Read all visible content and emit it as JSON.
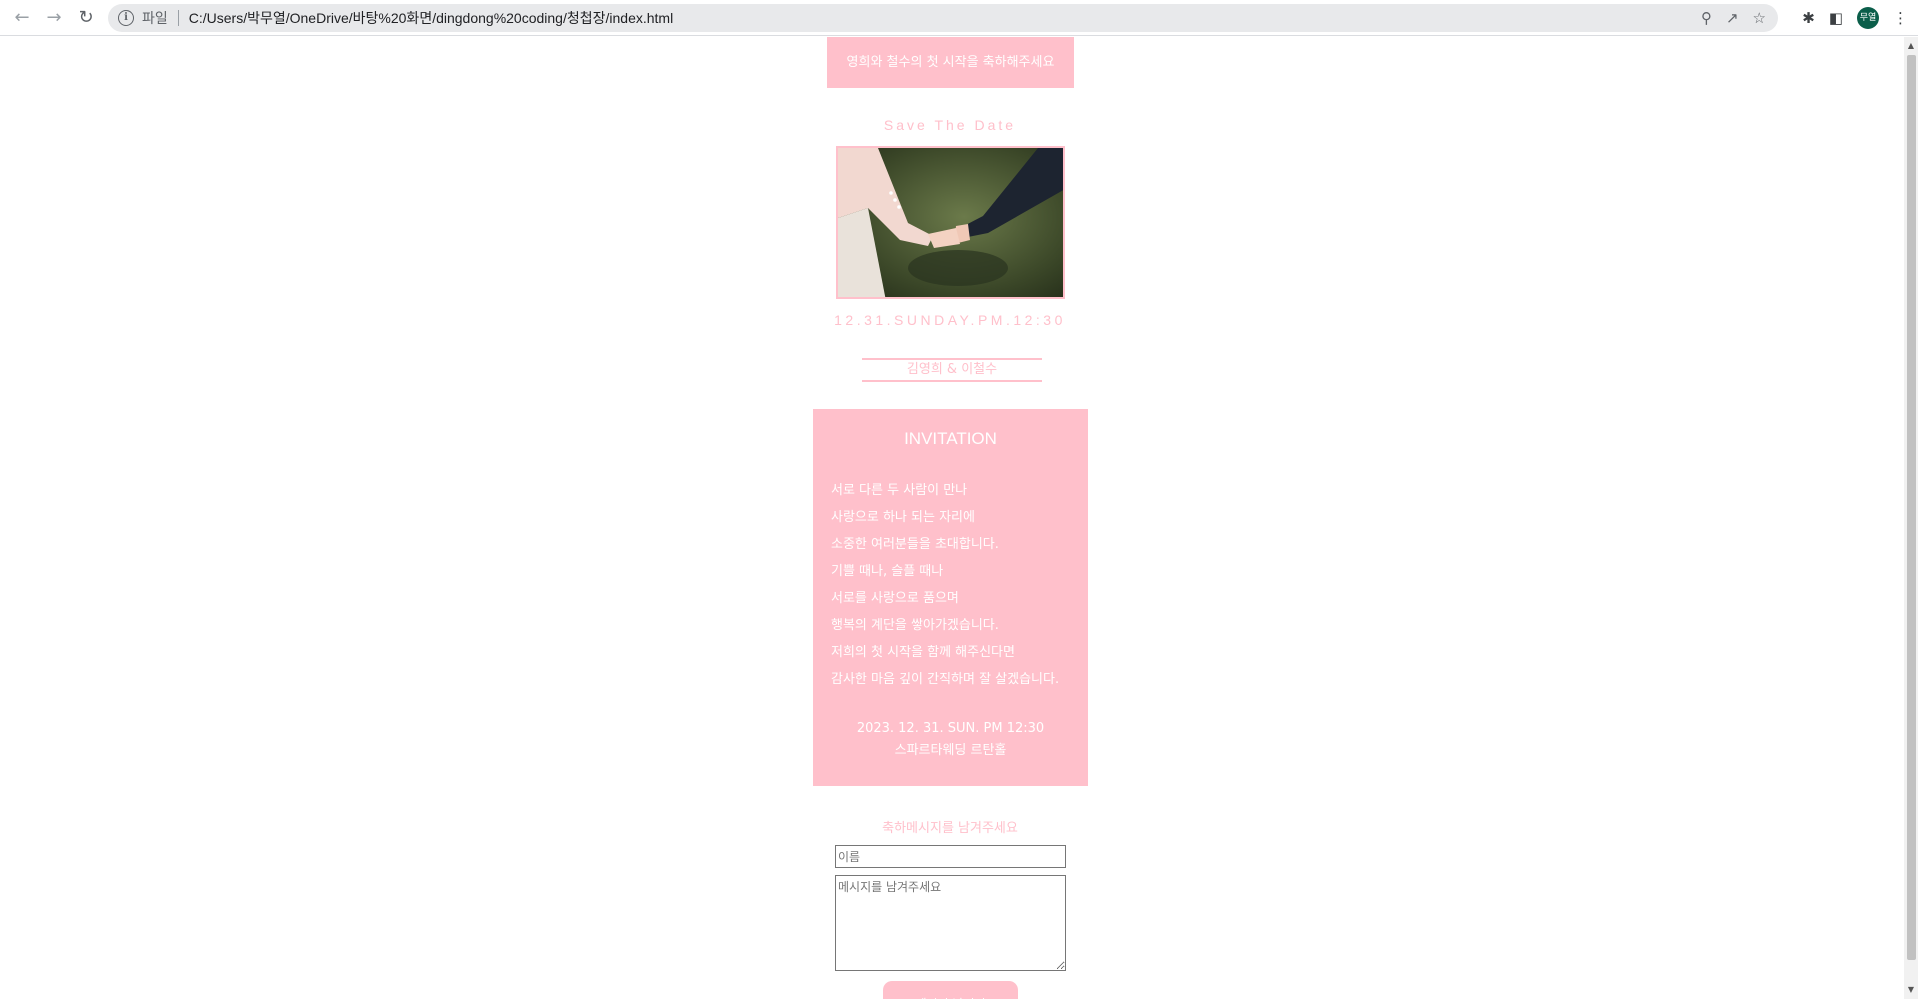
{
  "browser": {
    "scheme_label": "파일",
    "url": "C:/Users/박무열/OneDrive/바탕%20화면/dingdong%20coding/청첩장/index.html",
    "avatar_text": "무열"
  },
  "page": {
    "banner": "영희와 철수의 첫 시작을 축하해주세요",
    "save_the_date": "Save The Date",
    "date_line": "12.31.SUNDAY.PM.12:30",
    "couple_names": "김영희 & 이철수",
    "invitation": {
      "title": "INVITATION",
      "lines": [
        "서로 다른 두 사람이 만나",
        "사랑으로 하나 되는 자리에",
        "소중한 여러분들을 초대합니다.",
        "기쁠 때나, 슬플 때나",
        "서로를 사랑으로 품으며",
        "행복의 계단을 쌓아가겠습니다.",
        "저희의 첫 시작을 함께 해주신다면",
        "감사한 마음 깊이 간직하며 잘 살겠습니다."
      ],
      "datetime": "2023. 12. 31. SUN. PM 12:30",
      "venue": "스파르타웨딩 르탄홀"
    },
    "message": {
      "title": "축하메시지를 남겨주세요",
      "name_placeholder": "이름",
      "message_placeholder": "메시지를 남겨주세요",
      "submit_label": "메시지 남기기"
    }
  },
  "colors": {
    "accent": "#ffc0cb"
  }
}
